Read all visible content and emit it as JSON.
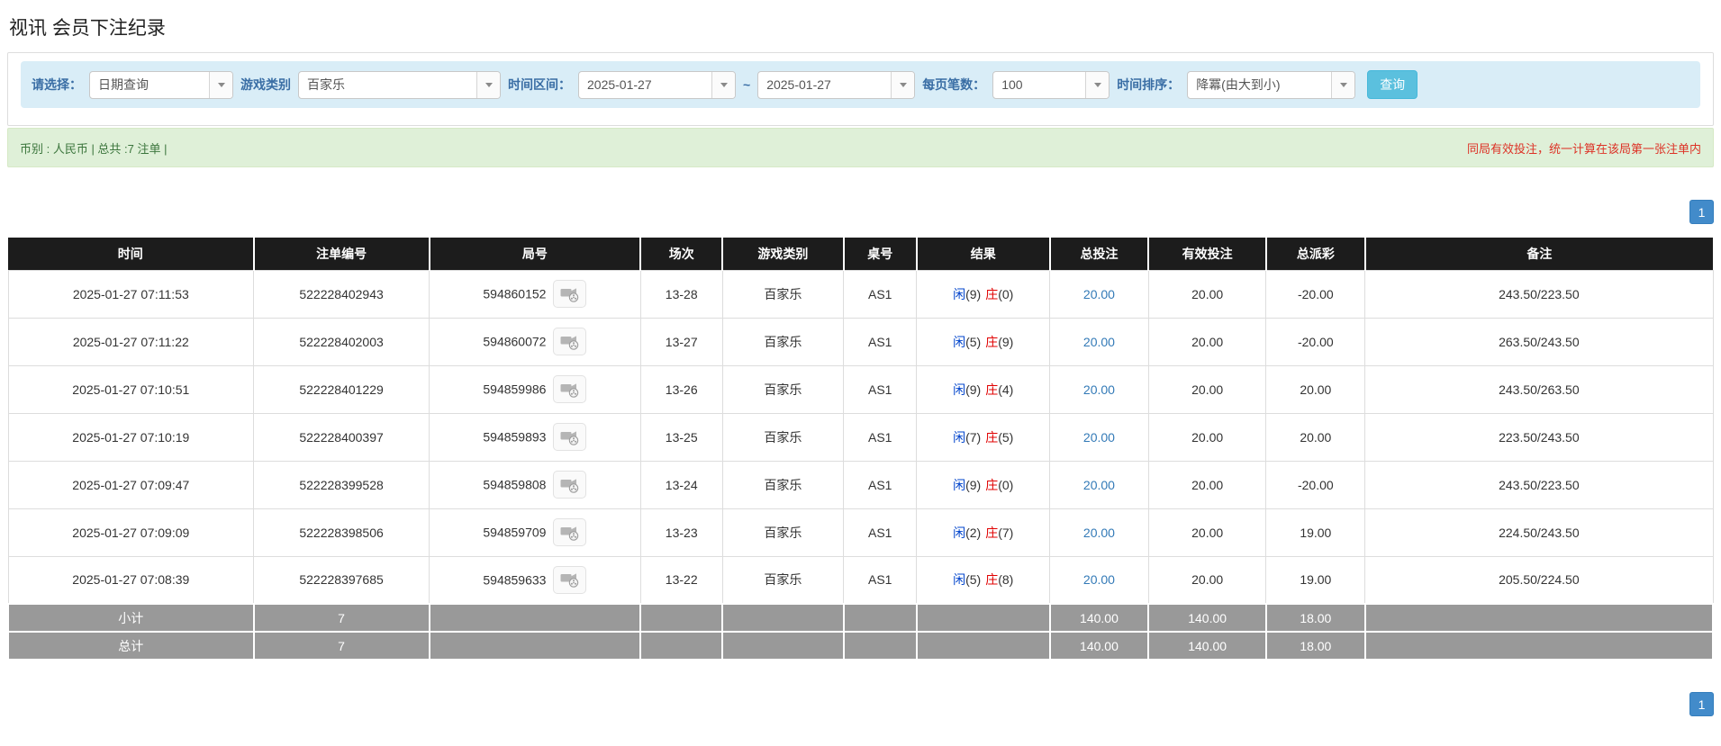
{
  "page": {
    "title": "视讯 会员下注纪录"
  },
  "filters": {
    "select_label": "请选择：",
    "select_value": "日期查询",
    "game_label": "游戏类别",
    "game_value": "百家乐",
    "range_label": "时间区间：",
    "date_from": "2025-01-27",
    "date_tilde": "~",
    "date_to": "2025-01-27",
    "per_page_label": "每页笔数：",
    "per_page_value": "100",
    "sort_label": "时间排序：",
    "sort_value": "降冪(由大到小)",
    "search_button": "查询"
  },
  "summary": {
    "left_text": "币别 : 人民币 | 总共 :7 注单 |",
    "right_text": "同局有效投注，统一计算在该局第一张注单内"
  },
  "pagination": {
    "page": "1"
  },
  "icons": {
    "combo_arrow": "chevron-down-icon",
    "round_video": "video-camera-icon"
  },
  "colors": {
    "filter_bar_bg": "#d9edf7",
    "filter_label": "#3a6ea5",
    "search_button_bg": "#5bc0de",
    "summary_bg": "#dff0d8",
    "summary_text": "#3c763d",
    "summary_warning": "#dd3226",
    "table_header_bg": "#1c1c1c",
    "totals_row_bg": "#999999",
    "link_blue": "#337ab7",
    "player_blue": "#0044cc",
    "banker_red": "#e00000",
    "negative_red": "#ff0000",
    "pagination_active_bg": "#428bca"
  },
  "table": {
    "headers": [
      "时间",
      "注单编号",
      "局号",
      "场次",
      "游戏类别",
      "桌号",
      "结果",
      "总投注",
      "有效投注",
      "总派彩",
      "备注"
    ],
    "rows": [
      {
        "time": "2025-01-27 07:11:53",
        "bet_id": "522228402943",
        "round_id": "594860152",
        "session": "13-28",
        "game": "百家乐",
        "table_no": "AS1",
        "result_player_label": "闲",
        "result_player_score": "(9)",
        "result_banker_label": "庄",
        "result_banker_score": "(0)",
        "total_bet": "20.00",
        "valid_bet": "20.00",
        "payout": "-20.00",
        "remark": "243.50/223.50"
      },
      {
        "time": "2025-01-27 07:11:22",
        "bet_id": "522228402003",
        "round_id": "594860072",
        "session": "13-27",
        "game": "百家乐",
        "table_no": "AS1",
        "result_player_label": "闲",
        "result_player_score": "(5)",
        "result_banker_label": "庄",
        "result_banker_score": "(9)",
        "total_bet": "20.00",
        "valid_bet": "20.00",
        "payout": "-20.00",
        "remark": "263.50/243.50"
      },
      {
        "time": "2025-01-27 07:10:51",
        "bet_id": "522228401229",
        "round_id": "594859986",
        "session": "13-26",
        "game": "百家乐",
        "table_no": "AS1",
        "result_player_label": "闲",
        "result_player_score": "(9)",
        "result_banker_label": "庄",
        "result_banker_score": "(4)",
        "total_bet": "20.00",
        "valid_bet": "20.00",
        "payout": "20.00",
        "remark": "243.50/263.50"
      },
      {
        "time": "2025-01-27 07:10:19",
        "bet_id": "522228400397",
        "round_id": "594859893",
        "session": "13-25",
        "game": "百家乐",
        "table_no": "AS1",
        "result_player_label": "闲",
        "result_player_score": "(7)",
        "result_banker_label": "庄",
        "result_banker_score": "(5)",
        "total_bet": "20.00",
        "valid_bet": "20.00",
        "payout": "20.00",
        "remark": "223.50/243.50"
      },
      {
        "time": "2025-01-27 07:09:47",
        "bet_id": "522228399528",
        "round_id": "594859808",
        "session": "13-24",
        "game": "百家乐",
        "table_no": "AS1",
        "result_player_label": "闲",
        "result_player_score": "(9)",
        "result_banker_label": "庄",
        "result_banker_score": "(0)",
        "total_bet": "20.00",
        "valid_bet": "20.00",
        "payout": "-20.00",
        "remark": "243.50/223.50"
      },
      {
        "time": "2025-01-27 07:09:09",
        "bet_id": "522228398506",
        "round_id": "594859709",
        "session": "13-23",
        "game": "百家乐",
        "table_no": "AS1",
        "result_player_label": "闲",
        "result_player_score": "(2)",
        "result_banker_label": "庄",
        "result_banker_score": "(7)",
        "total_bet": "20.00",
        "valid_bet": "20.00",
        "payout": "19.00",
        "remark": "224.50/243.50"
      },
      {
        "time": "2025-01-27 07:08:39",
        "bet_id": "522228397685",
        "round_id": "594859633",
        "session": "13-22",
        "game": "百家乐",
        "table_no": "AS1",
        "result_player_label": "闲",
        "result_player_score": "(5)",
        "result_banker_label": "庄",
        "result_banker_score": "(8)",
        "total_bet": "20.00",
        "valid_bet": "20.00",
        "payout": "19.00",
        "remark": "205.50/224.50"
      }
    ],
    "subtotal": {
      "label": "小计",
      "count": "7",
      "total_bet": "140.00",
      "valid_bet": "140.00",
      "payout": "18.00"
    },
    "total": {
      "label": "总计",
      "count": "7",
      "total_bet": "140.00",
      "valid_bet": "140.00",
      "payout": "18.00"
    }
  }
}
